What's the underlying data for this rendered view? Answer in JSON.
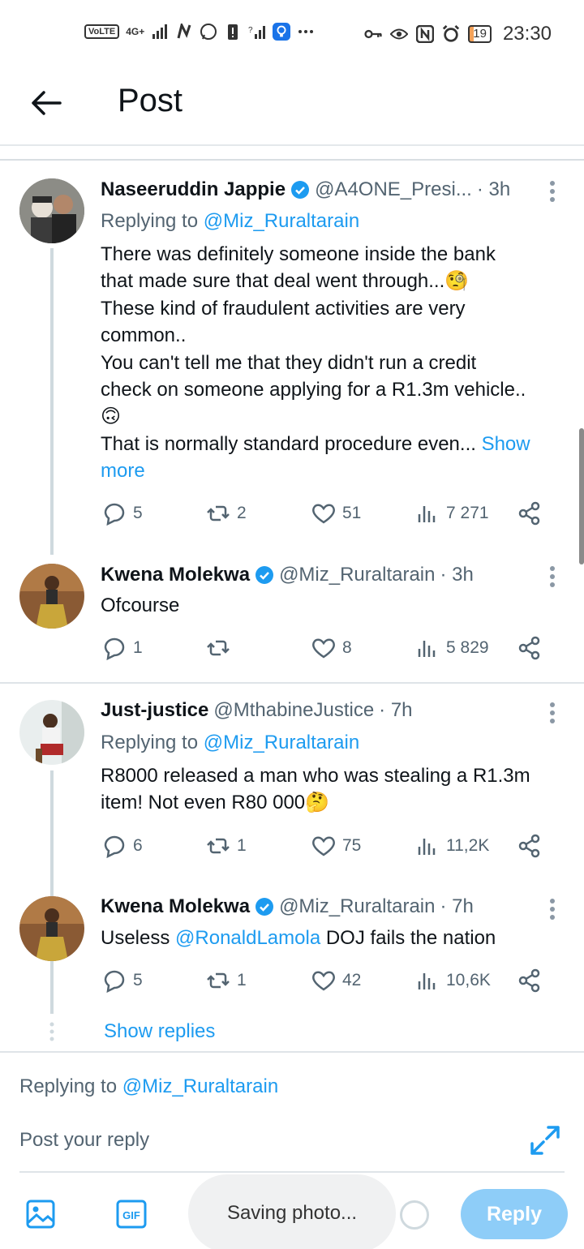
{
  "status_bar": {
    "volte": "VoLTE",
    "network": "4G+",
    "battery": "19",
    "time": "23:30"
  },
  "header": {
    "title": "Post"
  },
  "tweets": [
    {
      "name": "Naseeruddin Jappie",
      "handle": "@A4ONE_Presi...",
      "time": "· 3h",
      "replying_prefix": "Replying to ",
      "replying_to": "@Miz_Ruraltarain",
      "body_lines": [
        "There was definitely someone inside the bank",
        "that made sure that deal went through...🧐",
        "These kind of fraudulent activities are very",
        "common..",
        "You can't tell me that they didn't run a credit",
        "check on someone applying for a R1.3m vehicle..",
        "🙃",
        "That is normally standard procedure even..."
      ],
      "show_more_a": "Show",
      "show_more_b": "more",
      "replies": "5",
      "reposts": "2",
      "likes": "51",
      "views": "7 271"
    },
    {
      "name": "Kwena Molekwa",
      "handle": "@Miz_Ruraltarain",
      "time": "· 3h",
      "body": "Ofcourse",
      "replies": "1",
      "reposts": "",
      "likes": "8",
      "views": "5 829"
    },
    {
      "name": "Just-justice",
      "handle": "@MthabineJustice",
      "time": "· 7h",
      "replying_prefix": "Replying to ",
      "replying_to": "@Miz_Ruraltarain",
      "body_lines": [
        "R8000 released a man who was stealing a R1.3m",
        "item! Not even R80 000🤔"
      ],
      "replies": "6",
      "reposts": "1",
      "likes": "75",
      "views": "11,2K"
    },
    {
      "name": "Kwena Molekwa",
      "handle": "@Miz_Ruraltarain",
      "time": "· 7h",
      "body_prefix": "Useless ",
      "body_mention": "@RonaldLamola",
      "body_suffix": " DOJ fails the nation",
      "replies": "5",
      "reposts": "1",
      "likes": "42",
      "views": "10,6K"
    }
  ],
  "show_replies": "Show replies",
  "composer": {
    "replying_prefix": "Replying to ",
    "replying_to": "@Miz_Ruraltarain",
    "placeholder": "Post your reply",
    "toast": "Saving photo...",
    "reply_label": "Reply"
  },
  "colors": {
    "accent": "#1d9bf0",
    "reply_button": "#8ecdf8",
    "muted": "#536471"
  }
}
